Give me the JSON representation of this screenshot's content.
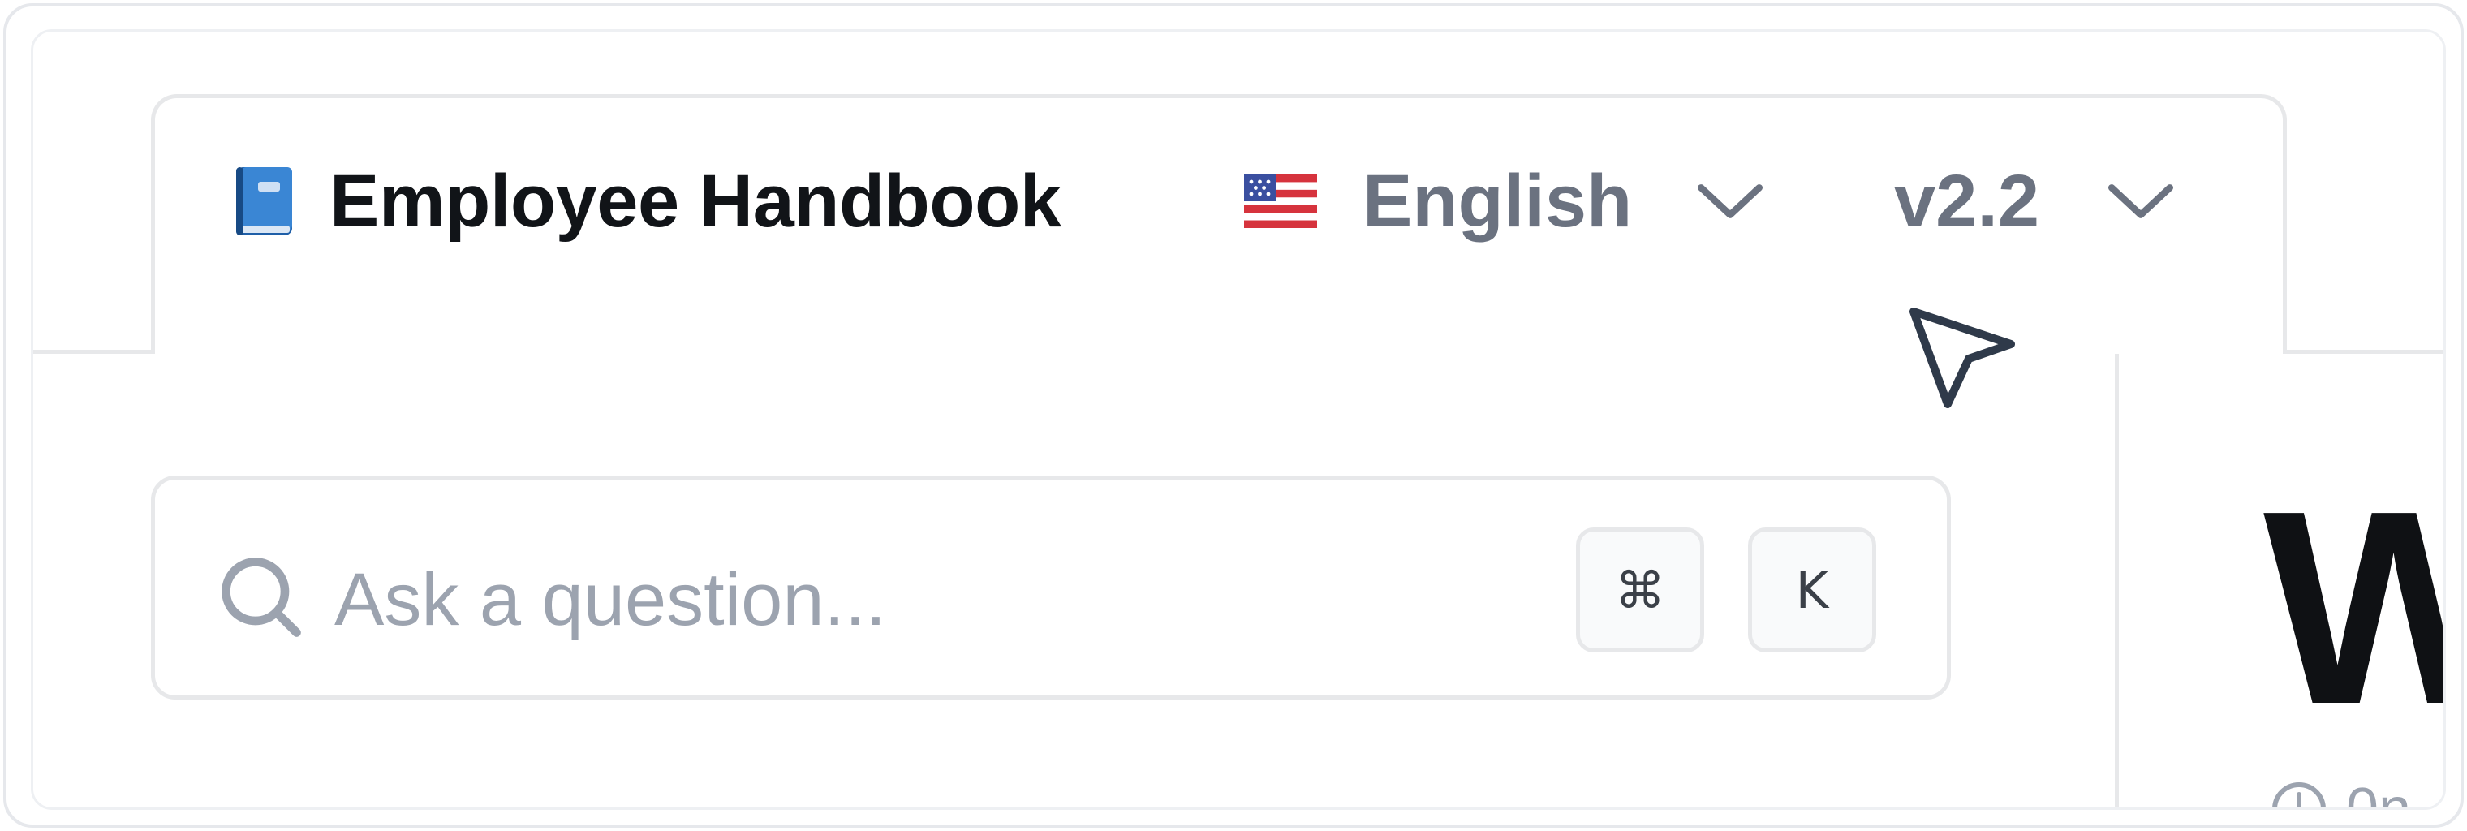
{
  "header": {
    "title": "Employee Handbook",
    "title_icon": "book-icon",
    "language": {
      "flag_icon": "us-flag-icon",
      "selected": "English",
      "chevron_icon": "chevron-down-icon"
    },
    "version": {
      "selected": "v2.2",
      "chevron_icon": "chevron-down-icon"
    }
  },
  "search": {
    "icon": "search-icon",
    "placeholder": "Ask a question...",
    "shortcut_keys": [
      "⌘",
      "K"
    ]
  },
  "main": {
    "heading_visible": "W",
    "meta_icon": "clock-icon",
    "meta_text_visible": "0n"
  },
  "colors": {
    "title_text": "#111418",
    "muted_text": "#6b7280",
    "placeholder_text": "#9ca3af",
    "border": "#e7e8ea",
    "cursor": "#2f3a4a"
  }
}
